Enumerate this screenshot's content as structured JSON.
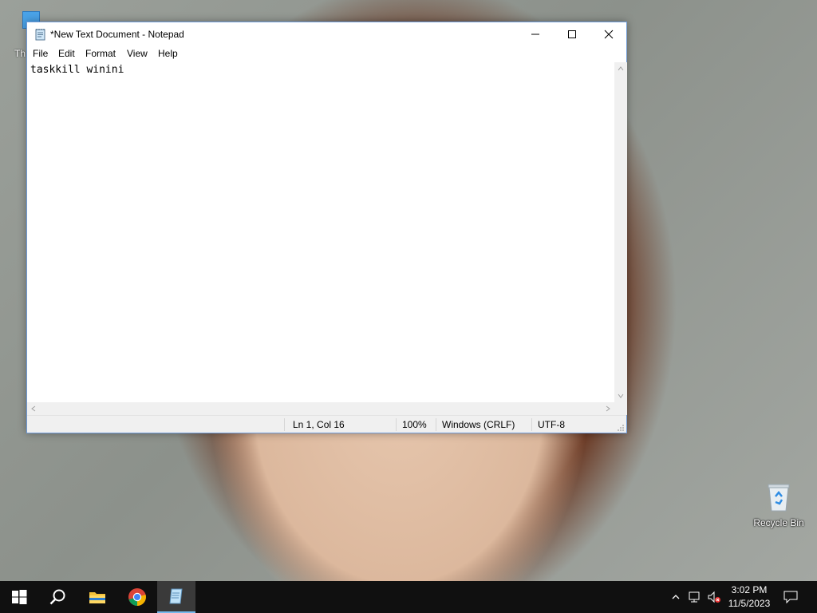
{
  "desktop": {
    "partial_icon_label": "Th",
    "recycle_bin_label": "Recycle Bin"
  },
  "window": {
    "title": "*New Text Document - Notepad",
    "menu": [
      "File",
      "Edit",
      "Format",
      "View",
      "Help"
    ],
    "content": "taskkill winini",
    "status": {
      "position": "Ln 1, Col 16",
      "zoom": "100%",
      "line_ending": "Windows (CRLF)",
      "encoding": "UTF-8"
    }
  },
  "taskbar": {
    "time": "3:02 PM",
    "date": "11/5/2023",
    "accent": "#76b9ed",
    "pinned": [
      "start-icon",
      "search-icon",
      "file-explorer-icon",
      "chrome-icon",
      "notepad-icon"
    ]
  }
}
